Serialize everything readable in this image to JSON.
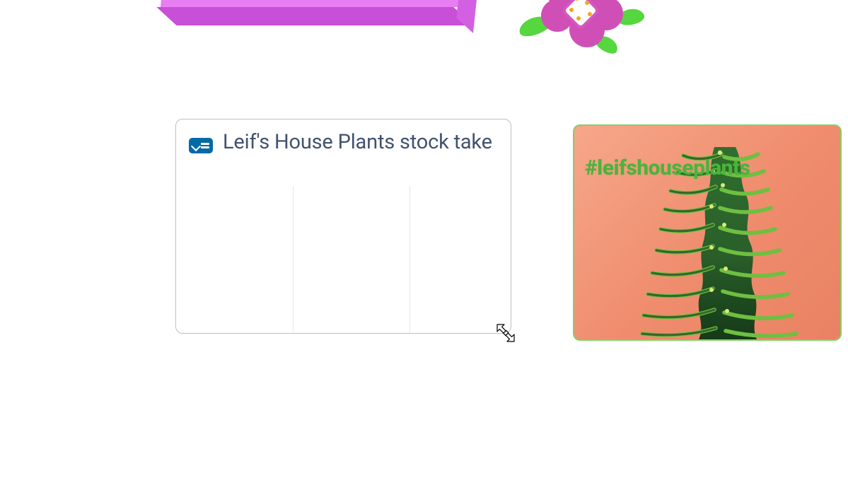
{
  "card": {
    "title": "Leif's House Plants stock take",
    "icon_name": "checklist-icon",
    "columns": 3
  },
  "image_card": {
    "hashtag": "#leifshouseplants",
    "accent_color": "#49b53c",
    "bg_color": "#f29a7d"
  },
  "decor": {
    "box_color": "#e77ef2",
    "flower_color": "#cf4fb7",
    "leaf_color": "#56d63f"
  },
  "cursor": {
    "type": "resize-nwse"
  }
}
